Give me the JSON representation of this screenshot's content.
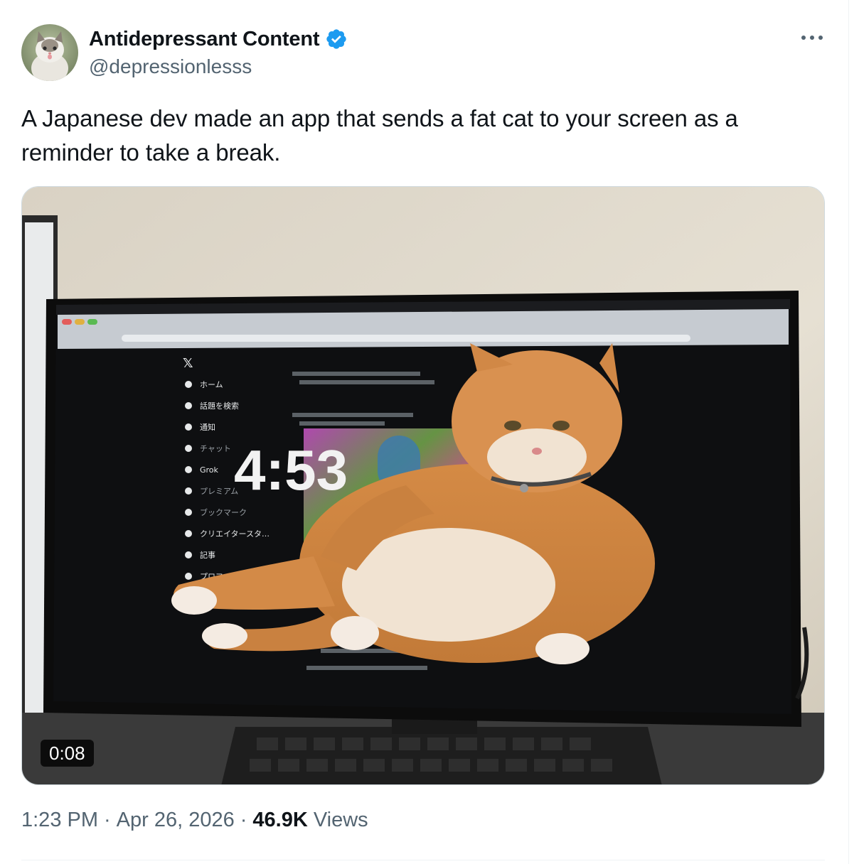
{
  "author": {
    "display_name": "Antidepressant Content",
    "handle": "@depressionlesss",
    "verified": true,
    "avatar": "cat-photo"
  },
  "tweet": {
    "text": "A Japanese dev made an app that sends a fat cat to your screen as a reminder to take a break."
  },
  "media": {
    "type": "video",
    "duration": "0:08",
    "on_screen_timer": "4:53",
    "monitor_sidebar": [
      "ホーム",
      "話題を検索",
      "通知",
      "チャット",
      "Grok",
      "プレミアム",
      "ブックマーク",
      "クリエイタースタ…",
      "記事",
      "プロフィール"
    ]
  },
  "meta": {
    "time": "1:23 PM",
    "separator": "·",
    "date": "Apr 26, 2026",
    "views_count": "46.9K",
    "views_label": "Views"
  },
  "colors": {
    "verified": "#1d9bf0",
    "secondary_text": "#536471",
    "primary_text": "#0f1419"
  },
  "icons": [
    "verified-badge-icon",
    "more-options-icon"
  ]
}
